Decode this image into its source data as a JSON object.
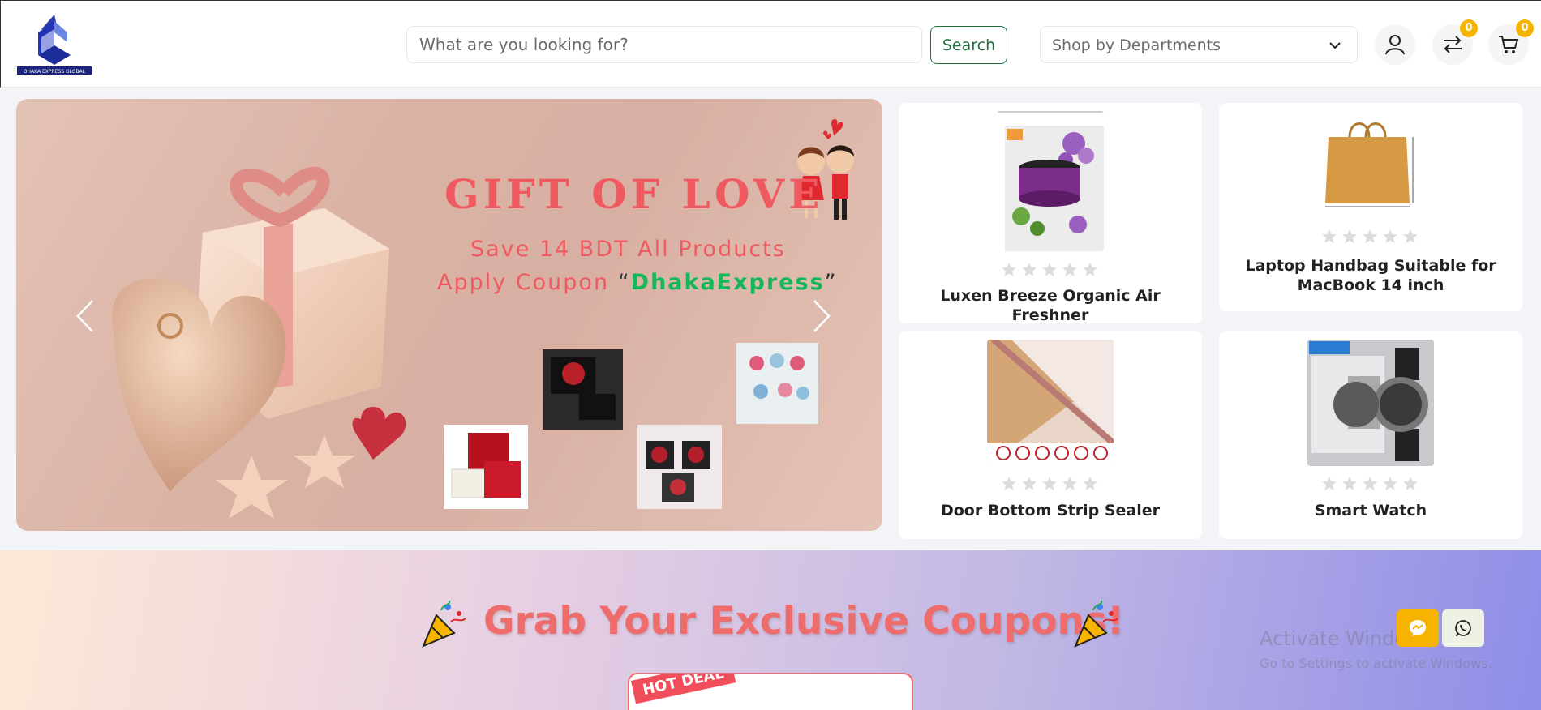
{
  "brand": {
    "logo_text": "DHAKA EXPRESS GLOBAL"
  },
  "header": {
    "search_placeholder": "What are you looking for?",
    "search_button": "Search",
    "department_label": "Shop by Departments",
    "compare_count": "0",
    "cart_count": "0"
  },
  "hero": {
    "title": "GIFT OF LOVE",
    "line1": "Save 14 BDT All Products",
    "line2_prefix": "Apply Coupon ",
    "open_quote": "“",
    "coupon_code": "DhakaExpress",
    "close_quote": "”"
  },
  "products": [
    {
      "name": "Luxen Breeze Organic Air Freshner",
      "rating": 0
    },
    {
      "name": "Laptop Handbag Suitable for MacBook 14 inch",
      "rating": 0
    },
    {
      "name": "Door Bottom Strip Sealer",
      "rating": 0
    },
    {
      "name": "Smart Watch",
      "rating": 0
    }
  ],
  "coupons": {
    "title": "Grab Your Exclusive Coupons!",
    "hot_deal": "HOT DEAL"
  },
  "watermark": {
    "line1": "Activate Windows",
    "line2": "Go to Settings to activate Windows."
  },
  "colors": {
    "accent_green": "#1f6f3f",
    "badge": "#f6b400",
    "hero_red": "#ef5a60",
    "coupon_green": "#18b65a",
    "messenger": "#f6b400",
    "whatsapp_bg": "#eef2e4"
  }
}
